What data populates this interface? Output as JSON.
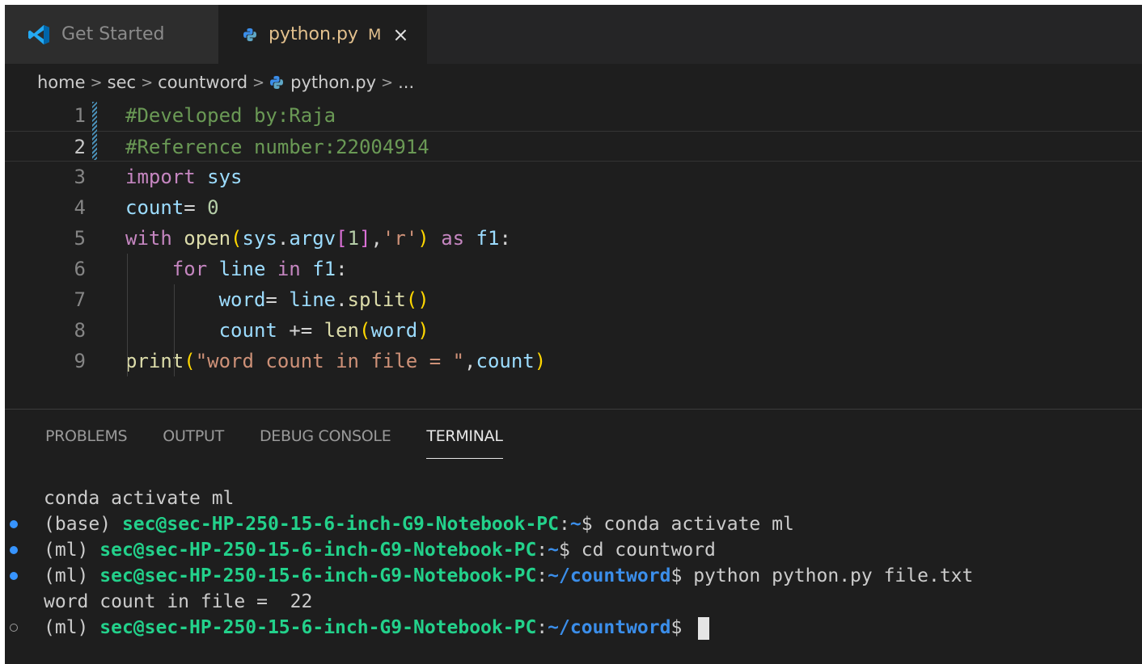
{
  "tabs": [
    {
      "label": "Get Started",
      "icon": "vscode-icon"
    },
    {
      "label": "python.py",
      "modified": "M",
      "icon": "python-icon",
      "close": "×"
    }
  ],
  "breadcrumb": {
    "items": [
      "home",
      "sec",
      "countword",
      "python.py",
      "..."
    ],
    "separator": ">"
  },
  "editor": {
    "active_line": 2,
    "lines": [
      {
        "n": "1",
        "tokens": [
          {
            "t": "#Developed by:Raja",
            "c": "cm"
          }
        ]
      },
      {
        "n": "2",
        "tokens": [
          {
            "t": "#Reference number:22004914",
            "c": "cm"
          }
        ]
      },
      {
        "n": "3",
        "tokens": [
          {
            "t": "import",
            "c": "kw"
          },
          {
            "t": " ",
            "c": "op"
          },
          {
            "t": "sys",
            "c": "vr"
          }
        ]
      },
      {
        "n": "4",
        "tokens": [
          {
            "t": "count",
            "c": "vr"
          },
          {
            "t": "= ",
            "c": "op"
          },
          {
            "t": "0",
            "c": "nm"
          }
        ]
      },
      {
        "n": "5",
        "tokens": [
          {
            "t": "with",
            "c": "kw"
          },
          {
            "t": " ",
            "c": "op"
          },
          {
            "t": "open",
            "c": "fn"
          },
          {
            "t": "(",
            "c": "p1"
          },
          {
            "t": "sys",
            "c": "vr"
          },
          {
            "t": ".",
            "c": "op"
          },
          {
            "t": "argv",
            "c": "vr"
          },
          {
            "t": "[",
            "c": "p2"
          },
          {
            "t": "1",
            "c": "nm"
          },
          {
            "t": "]",
            "c": "p2"
          },
          {
            "t": ",",
            "c": "op"
          },
          {
            "t": "'r'",
            "c": "st"
          },
          {
            "t": ")",
            "c": "p1"
          },
          {
            "t": " ",
            "c": "op"
          },
          {
            "t": "as",
            "c": "kw"
          },
          {
            "t": " ",
            "c": "op"
          },
          {
            "t": "f1",
            "c": "vr"
          },
          {
            "t": ":",
            "c": "op"
          }
        ]
      },
      {
        "n": "6",
        "tokens": [
          {
            "t": "    ",
            "c": "op"
          },
          {
            "t": "for",
            "c": "kw"
          },
          {
            "t": " ",
            "c": "op"
          },
          {
            "t": "line",
            "c": "vr"
          },
          {
            "t": " ",
            "c": "op"
          },
          {
            "t": "in",
            "c": "kw"
          },
          {
            "t": " ",
            "c": "op"
          },
          {
            "t": "f1",
            "c": "vr"
          },
          {
            "t": ":",
            "c": "op"
          }
        ]
      },
      {
        "n": "7",
        "tokens": [
          {
            "t": "        ",
            "c": "op"
          },
          {
            "t": "word",
            "c": "vr"
          },
          {
            "t": "= ",
            "c": "op"
          },
          {
            "t": "line",
            "c": "vr"
          },
          {
            "t": ".",
            "c": "op"
          },
          {
            "t": "split",
            "c": "fn"
          },
          {
            "t": "()",
            "c": "p1"
          }
        ]
      },
      {
        "n": "8",
        "tokens": [
          {
            "t": "        ",
            "c": "op"
          },
          {
            "t": "count",
            "c": "vr"
          },
          {
            "t": " += ",
            "c": "op"
          },
          {
            "t": "len",
            "c": "fn"
          },
          {
            "t": "(",
            "c": "p1"
          },
          {
            "t": "word",
            "c": "vr"
          },
          {
            "t": ")",
            "c": "p1"
          }
        ]
      },
      {
        "n": "9",
        "tokens": [
          {
            "t": "print",
            "c": "fn"
          },
          {
            "t": "(",
            "c": "p1"
          },
          {
            "t": "\"word count in file = \"",
            "c": "st"
          },
          {
            "t": ",",
            "c": "op"
          },
          {
            "t": "count",
            "c": "vr"
          },
          {
            "t": ")",
            "c": "p1"
          }
        ]
      }
    ]
  },
  "panel": {
    "tabs": [
      "PROBLEMS",
      "OUTPUT",
      "DEBUG CONSOLE",
      "TERMINAL"
    ],
    "active_tab": "TERMINAL"
  },
  "terminal": {
    "lines": [
      {
        "status": "none",
        "text": "conda activate ml"
      },
      {
        "status": "ok",
        "env": "(base)",
        "userhost": "sec@sec-HP-250-15-6-inch-G9-Notebook-PC",
        "path": "~",
        "cmd": "conda activate ml"
      },
      {
        "status": "ok",
        "env": "(ml)",
        "userhost": "sec@sec-HP-250-15-6-inch-G9-Notebook-PC",
        "path": "~",
        "cmd": "cd countword"
      },
      {
        "status": "ok",
        "env": "(ml)",
        "userhost": "sec@sec-HP-250-15-6-inch-G9-Notebook-PC",
        "path": "~/countword",
        "cmd": "python python.py file.txt"
      },
      {
        "status": "none",
        "text": "word count in file =  22"
      },
      {
        "status": "pending",
        "env": "(ml)",
        "userhost": "sec@sec-HP-250-15-6-inch-G9-Notebook-PC",
        "path": "~/countword",
        "cmd": ""
      }
    ]
  },
  "colors": {
    "editor_bg": "#1e1e1e",
    "tabbar_bg": "#252526",
    "comment": "#6a9955",
    "keyword": "#c586c0",
    "string": "#ce9178",
    "terminal_green": "#23d18b",
    "terminal_blue": "#3b8eea",
    "status_dot": "#3794ff"
  }
}
